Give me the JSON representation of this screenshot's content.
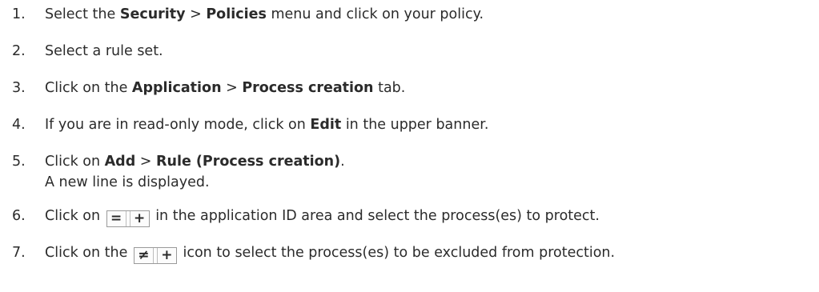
{
  "steps": [
    {
      "num": "1.",
      "a": "Select the ",
      "b": "Security",
      "c": " > ",
      "d": "Policies",
      "e": " menu and click on your policy."
    },
    {
      "num": "2.",
      "a": "Select a rule set."
    },
    {
      "num": "3.",
      "a": "Click on the ",
      "b": "Application",
      "c": " > ",
      "d": "Process creation",
      "e": " tab."
    },
    {
      "num": "4.",
      "a": "If you are in read-only mode, click on ",
      "b": "Edit",
      "e": " in the upper banner."
    },
    {
      "num": "5.",
      "a": "Click on ",
      "b": "Add",
      "c": " > ",
      "d": "Rule (Process creation)",
      "e": ".",
      "sub": "A new line is displayed."
    },
    {
      "num": "6.",
      "a": "Click on ",
      "e": " in the application ID area and select the process(es) to protect.",
      "icon_left": "=",
      "icon_right": "+"
    },
    {
      "num": "7.",
      "a": "Click on the ",
      "e": " icon to select the process(es) to be excluded from protection.",
      "icon_left": "≠",
      "icon_right": "+"
    }
  ],
  "icons": [
    "equals-add-icon",
    "not-equals-add-icon"
  ]
}
